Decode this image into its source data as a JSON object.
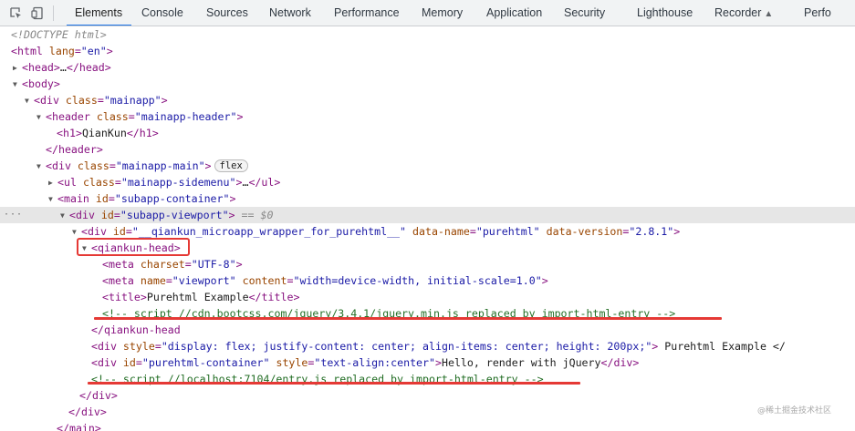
{
  "toolbar": {
    "tabs": [
      {
        "label": "Elements",
        "active": true
      },
      {
        "label": "Console"
      },
      {
        "label": "Sources"
      },
      {
        "label": "Network"
      },
      {
        "label": "Performance"
      },
      {
        "label": "Memory"
      },
      {
        "label": "Application"
      },
      {
        "label": "Security"
      },
      {
        "label": "Lighthouse"
      },
      {
        "label": "Recorder"
      },
      {
        "label": "Perfo"
      }
    ],
    "icons": [
      "inspect-element-icon",
      "device-toolbar-icon",
      "flask-icon"
    ]
  },
  "dom": {
    "doctype": "<!DOCTYPE html>",
    "selected_ref": "$0",
    "flex_badge": "flex",
    "lines": {
      "html_open": {
        "tag": "html",
        "attr": "lang",
        "val": "en"
      },
      "head": {
        "tag": "head"
      },
      "body": {
        "tag": "body"
      },
      "mainapp": {
        "tag": "div",
        "attr": "class",
        "val": "mainapp"
      },
      "header": {
        "tag": "header",
        "attr": "class",
        "val": "mainapp-header"
      },
      "h1": {
        "tag": "h1",
        "text": "QianKun"
      },
      "header_close": {
        "tag": "header"
      },
      "main_div": {
        "tag": "div",
        "attr": "class",
        "val": "mainapp-main"
      },
      "ul": {
        "tag": "ul",
        "attr": "class",
        "val": "mainapp-sidemenu"
      },
      "main": {
        "tag": "main",
        "attr": "id",
        "val": "subapp-container"
      },
      "viewport": {
        "tag": "div",
        "attr": "id",
        "val": "subapp-viewport"
      },
      "wrapper": {
        "tag": "div",
        "attr": "id",
        "val": "__qiankun_microapp_wrapper_for_purehtml__",
        "attr2": "data-name",
        "val2": "purehtml",
        "attr3": "data-version",
        "val3": "2.8.1"
      },
      "qiankun_head": {
        "tag": "qiankun-head"
      },
      "meta1": {
        "tag": "meta",
        "attr": "charset",
        "val": "UTF-8"
      },
      "meta2": {
        "tag": "meta",
        "attr": "name",
        "val": "viewport",
        "attr2": "content",
        "val2": "width=device-width, initial-scale=1.0"
      },
      "title": {
        "tag": "title",
        "text": "Purehtml Example"
      },
      "comment1": "<!--  script //cdn.bootcss.com/jquery/3.4.1/jquery.min.js replaced by import-html-entry -->",
      "qiankun_head_close": {
        "tag": "qiankun-head"
      },
      "style_div": {
        "tag": "div",
        "attr": "style",
        "val": "display: flex; justify-content: center; align-items: center; height: 200px;",
        "text": "Purehtml Example </"
      },
      "container_div": {
        "tag": "div",
        "attr": "id",
        "val": "purehtml-container",
        "attr2": "style",
        "val2": "text-align:center",
        "text": "Hello, render with jQuery"
      },
      "comment2": "<!--  script //localhost:7104/entry.js replaced by import-html-entry -->",
      "div_close1": {
        "tag": "div"
      },
      "div_close2": {
        "tag": "div"
      },
      "main_close": {
        "tag": "main"
      }
    }
  },
  "watermark": "@稀土掘金技术社区",
  "colors": {
    "tag": "#881280",
    "attr_name": "#994500",
    "attr_value": "#1a1aa6",
    "comment": "#236e25",
    "highlight": "#e53935",
    "active_tab": "#1a73e8"
  }
}
